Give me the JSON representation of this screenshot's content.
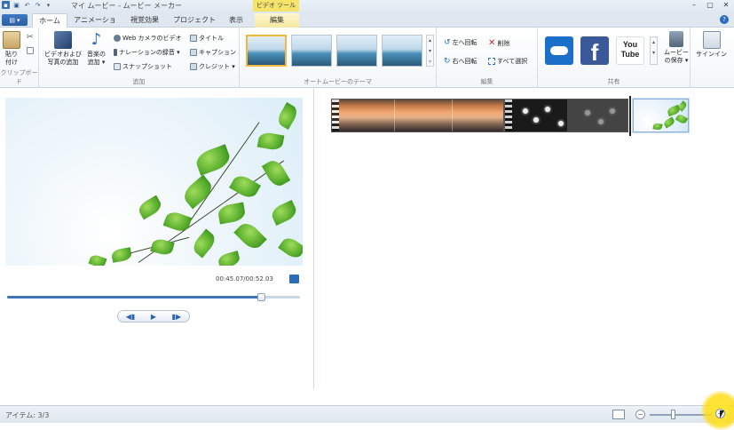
{
  "title_bar": {
    "app_title": "マイ ムービー - ムービー メーカー",
    "contextual_tools": "ビデオ ツール",
    "qat_icons": [
      "save-icon",
      "undo-icon",
      "redo-icon",
      "dropdown-icon"
    ],
    "window_controls": [
      "minimize",
      "maximize",
      "close"
    ]
  },
  "tabs": {
    "file": "▤",
    "items": [
      "ホーム",
      "アニメーション",
      "視覚効果",
      "プロジェクト",
      "表示",
      "編集"
    ],
    "active": "ホーム"
  },
  "ribbon": {
    "clipboard": {
      "label": "クリップボード",
      "paste": "貼り\n付け"
    },
    "add": {
      "label": "追加",
      "add_video_photo": "ビデオおよび\n写真の追加",
      "add_music": "音楽の\n追加 ▾",
      "webcam": "Web カメラのビデオ",
      "narration": "ナレーションの録音 ▾",
      "snapshot": "スナップショット",
      "title": "タイトル",
      "caption": "キャプション",
      "credits": "クレジット ▾"
    },
    "themes": {
      "label": "オートムービーのテーマ"
    },
    "editing": {
      "label": "編集",
      "rotate_left": "左へ回転",
      "rotate_right": "右へ回転",
      "remove": "削除",
      "select_all": "すべて選択"
    },
    "share": {
      "label": "共有",
      "save_movie": "ムービー\nの保存 ▾",
      "youtube_text": "You\nTube"
    },
    "signin": "サインイン"
  },
  "preview": {
    "timecode": "00:45.07/00:52.03",
    "progress": 0.866
  },
  "status": {
    "items_text": "アイテム: 3/3"
  },
  "colors": {
    "accent": "#2b579a",
    "tools_tab": "#f6e36a",
    "zoom_highlight": "#ffe428"
  }
}
